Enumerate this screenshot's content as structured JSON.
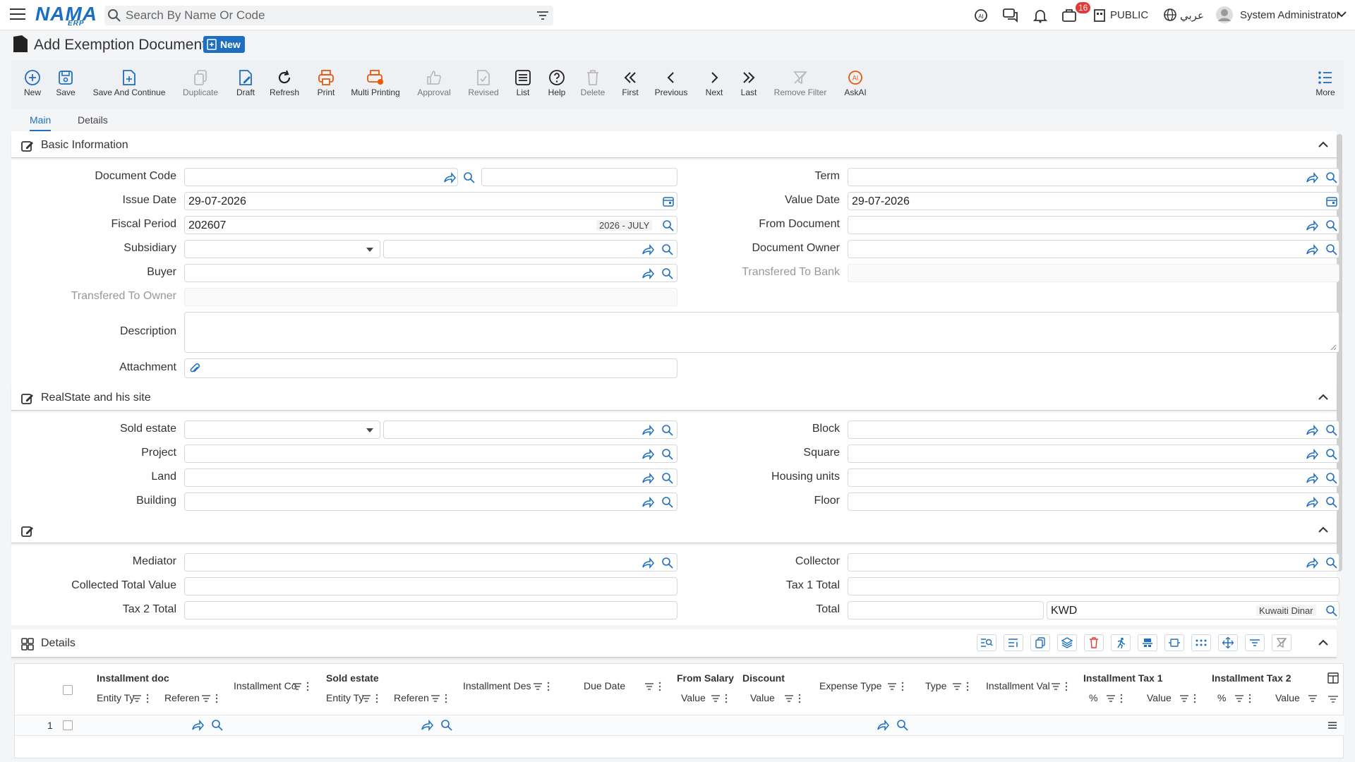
{
  "topbar": {
    "logo": "NAMA",
    "logo_sub": "ERP",
    "search_placeholder": "Search By Name Or Code",
    "notification_count": "16",
    "company": "PUBLIC",
    "language": "عربي",
    "user": "System Administrator"
  },
  "page": {
    "title": "Add Exemption Document",
    "status": "New"
  },
  "toolbar": {
    "new": "New",
    "save": "Save",
    "save_continue": "Save And Continue",
    "duplicate": "Duplicate",
    "draft": "Draft",
    "refresh": "Refresh",
    "print": "Print",
    "multi_printing": "Multi Printing",
    "approval": "Approval",
    "revised": "Revised",
    "list": "List",
    "help": "Help",
    "delete": "Delete",
    "first": "First",
    "previous": "Previous",
    "next": "Next",
    "last": "Last",
    "remove_filter": "Remove Filter",
    "askai": "AskAI",
    "more": "More"
  },
  "tabs": {
    "main": "Main",
    "details": "Details"
  },
  "basic": {
    "title": "Basic Information",
    "document_code": "Document Code",
    "issue_date": "Issue Date",
    "issue_date_value": "29-07-2026",
    "fiscal_period": "Fiscal Period",
    "fiscal_period_value": "202607",
    "fiscal_period_tag": "2026 - JULY",
    "subsidiary": "Subsidiary",
    "buyer": "Buyer",
    "transfered_to_owner": "Transfered To Owner",
    "description": "Description",
    "attachment": "Attachment",
    "term": "Term",
    "value_date": "Value Date",
    "value_date_value": "29-07-2026",
    "from_document": "From Document",
    "document_owner": "Document Owner",
    "transfered_to_bank": "Transfered To Bank"
  },
  "realstate": {
    "title": "RealState and his site",
    "sold_estate": "Sold estate",
    "project": "Project",
    "land": "Land",
    "building": "Building",
    "block": "Block",
    "square": "Square",
    "housing_units": "Housing units",
    "floor": "Floor"
  },
  "collect": {
    "mediator": "Mediator",
    "collected_total_value": "Collected Total Value",
    "tax2_total": "Tax 2 Total",
    "collector": "Collector",
    "tax1_total": "Tax 1 Total",
    "total": "Total",
    "currency_code": "KWD",
    "currency_name": "Kuwaiti Dinar"
  },
  "details": {
    "title": "Details",
    "columns": {
      "installment_doc": "Installment doc",
      "entity_type": "Entity Ty",
      "reference": "Referen",
      "installment_code": "Installment Co",
      "sold_estate": "Sold estate",
      "installment_desc": "Installment Des",
      "due_date": "Due Date",
      "from_salary": "From Salary",
      "discount": "Discount",
      "value": "Value",
      "expense_type": "Expense Type",
      "type": "Type",
      "installment_value": "Installment Val",
      "installment_tax1": "Installment Tax 1",
      "installment_tax2": "Installment Tax 2",
      "percent": "%"
    },
    "row_number": "1"
  }
}
